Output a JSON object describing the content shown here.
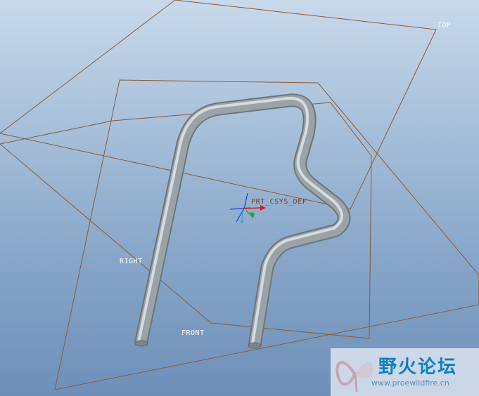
{
  "datum_planes": {
    "top": "TOP",
    "right": "RIGHT",
    "front": "FRONT"
  },
  "coordinate_system": {
    "label": "PRT_CSYS_DEF"
  },
  "model": {
    "icon": "bent-wire-pipe-part"
  },
  "colors": {
    "datum_edge": "#8b5a36",
    "pipe_body": "#9aa3a8",
    "pipe_highlight": "#e9eef0",
    "csys_x": "#d11c1c",
    "csys_y": "#18a838",
    "csys_z": "#1f3fe0",
    "background_top": "#c8d9ea",
    "background_bottom": "#6e8fb9"
  },
  "watermark": {
    "title": "野火论坛",
    "url": "www.proewildfire.cn",
    "logo_icon": "butterfly-logo-icon"
  }
}
